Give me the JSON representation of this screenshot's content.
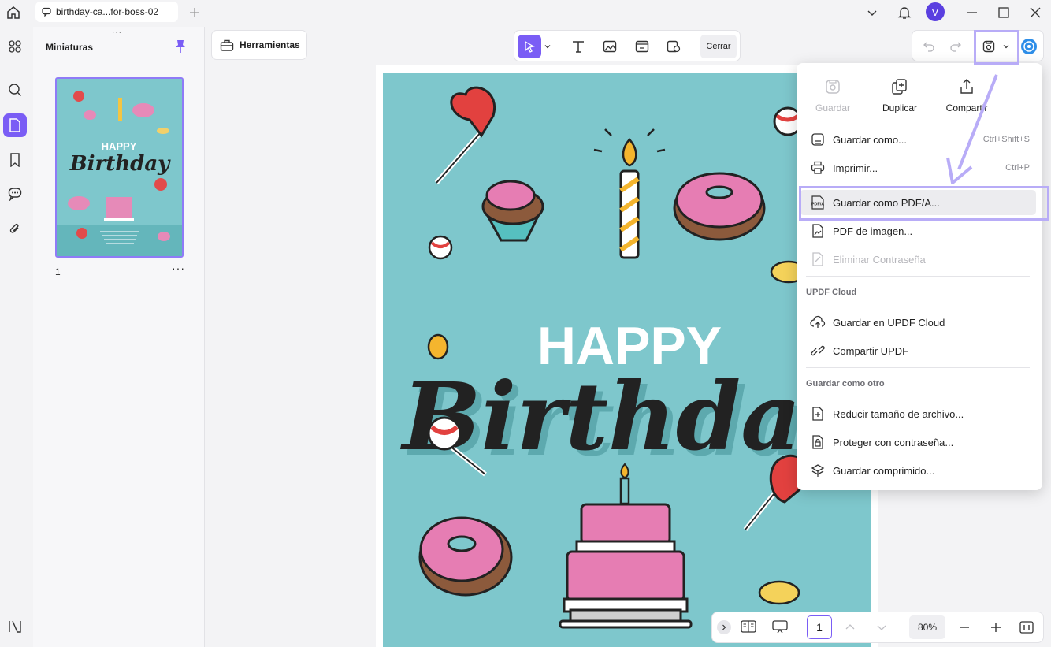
{
  "tab": {
    "title": "birthday-ca...for-boss-02"
  },
  "user": {
    "avatar_letter": "V"
  },
  "thumbnails": {
    "title": "Miniaturas",
    "page_number": "1",
    "more": "···"
  },
  "toolbar": {
    "tools_label": "Herramientas",
    "close_label": "Cerrar"
  },
  "document": {
    "happy": "HAPPY",
    "birthday": "Birthday"
  },
  "page_nav": {
    "current_page": "1",
    "zoom": "80%"
  },
  "menu": {
    "top_actions": [
      {
        "label": "Guardar",
        "icon": "save-icon",
        "disabled": true
      },
      {
        "label": "Duplicar",
        "icon": "duplicate-icon"
      },
      {
        "label": "Compartir",
        "icon": "share-icon"
      }
    ],
    "items": [
      {
        "label": "Guardar como...",
        "shortcut": "Ctrl+Shift+S",
        "icon": "save-as-icon"
      },
      {
        "label": "Imprimir...",
        "shortcut": "Ctrl+P",
        "icon": "printer-icon"
      },
      {
        "label": "Guardar como PDF/A...",
        "icon": "pdfa-icon",
        "highlighted": true
      },
      {
        "label": "PDF de imagen...",
        "icon": "image-pdf-icon"
      },
      {
        "label": "Eliminar Contraseña",
        "icon": "remove-password-icon",
        "disabled": true
      }
    ],
    "cloud_section": "UPDF Cloud",
    "cloud_items": [
      {
        "label": "Guardar en UPDF Cloud",
        "icon": "cloud-upload-icon"
      },
      {
        "label": "Compartir UPDF",
        "icon": "link-icon"
      }
    ],
    "other_section": "Guardar como otro",
    "other_items": [
      {
        "label": "Reducir tamaño de archivo...",
        "icon": "reduce-size-icon"
      },
      {
        "label": "Proteger con contraseña...",
        "icon": "lock-icon"
      },
      {
        "label": "Guardar comprimido...",
        "icon": "compress-icon"
      }
    ]
  },
  "colors": {
    "accent": "#7a5df5",
    "card_bg": "#7ec7cc",
    "highlight": "#b8acf7"
  }
}
